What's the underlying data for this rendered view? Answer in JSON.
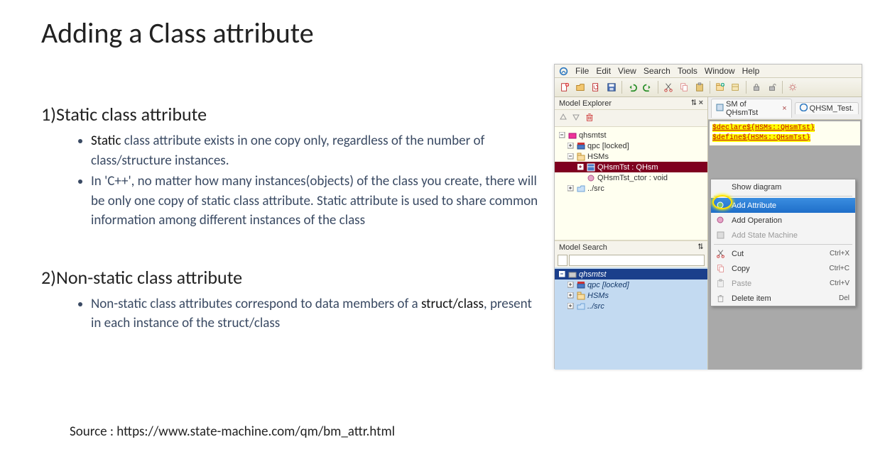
{
  "title": "Adding a Class attribute",
  "section1": {
    "heading": "1)Static class attribute",
    "bullets": [
      {
        "pre": "Static",
        "post": " class attribute exists in one copy only, regardless of the number of class/structure instances."
      },
      {
        "pre": "",
        "post": "In 'C++', no matter how many instances(objects) of the class you create, there will be only one copy of static class attribute. Static attribute is used to share common information among different instances of the class"
      }
    ]
  },
  "section2": {
    "heading": "2)Non-static class attribute",
    "bullets": [
      {
        "pre": "",
        "mid_before": "Non-static class attributes correspond to data members of a ",
        "blk": "struct/class",
        "mid_after": ", present in each instance of the struct/class"
      }
    ]
  },
  "source": "Source : https://www.state-machine.com/qm/bm_attr.html",
  "shot": {
    "menu": [
      "File",
      "Edit",
      "View",
      "Search",
      "Tools",
      "Window",
      "Help"
    ],
    "explorer_title": "Model Explorer",
    "pin_symbol": "⮁",
    "tree": {
      "root": "qhsmtst",
      "n_qpc": "qpc [locked]",
      "n_hsms": "HSMs",
      "n_class": "QHsmTst : QHsm",
      "n_ctor": "QHsmTst_ctor : void",
      "n_src": "../src"
    },
    "search_title": "Model Search",
    "stree": {
      "root": "qhsmtst",
      "qpc": "qpc [locked]",
      "hsms": "HSMs",
      "src": "../src"
    },
    "tabs": {
      "sm": "SM of QHsmTst",
      "file": "QHSM_Test."
    },
    "code": {
      "l1": "$declare${HSMs::QHsmTst}",
      "l2": "$define${HSMs::QHsmTst}"
    },
    "ctx": {
      "show_diagram": "Show diagram",
      "add_attr": "Add Attribute",
      "add_op": "Add Operation",
      "add_sm": "Add State Machine",
      "cut": "Cut",
      "copy": "Copy",
      "paste": "Paste",
      "delete": "Delete item",
      "kb_cut": "Ctrl+X",
      "kb_copy": "Ctrl+C",
      "kb_paste": "Ctrl+V",
      "kb_del": "Del"
    }
  }
}
